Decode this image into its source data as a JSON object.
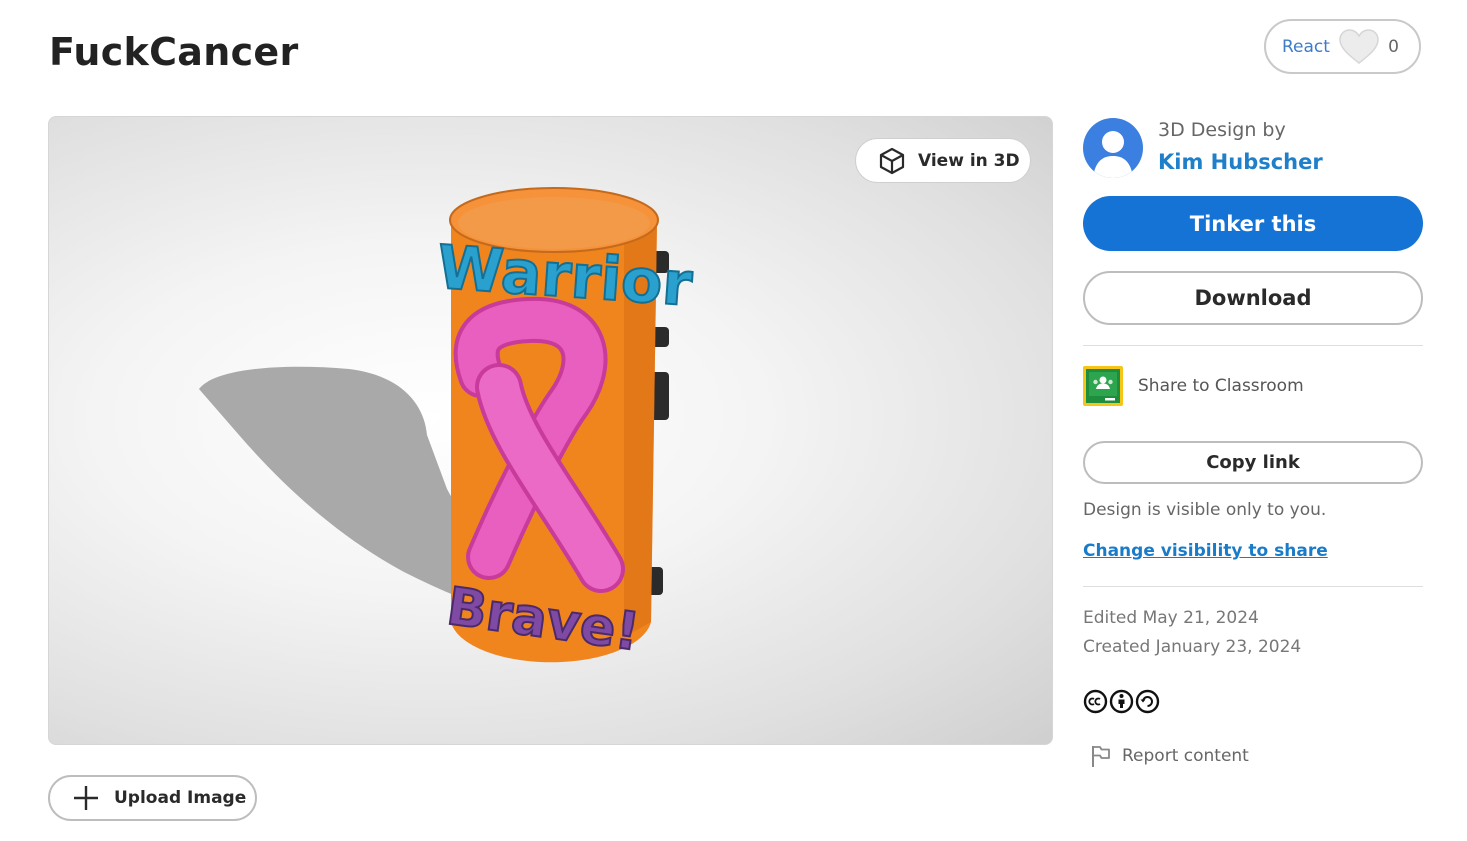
{
  "page": {
    "title": "FuckCancer"
  },
  "react": {
    "label": "React",
    "count": "0",
    "icon": "heart-icon"
  },
  "viewer": {
    "view3d_label": "View in 3D",
    "model_text_top": "Warrior",
    "model_text_bottom": "Brave!",
    "colors": {
      "body": "#f0851e",
      "ribbon": "#e85fc0",
      "top_text": "#2aa0cf",
      "bottom_text": "#7e4aa3"
    }
  },
  "upload": {
    "label": "Upload Image"
  },
  "sidebar": {
    "by_label": "3D Design by",
    "author": "Kim Hubscher",
    "tinker_label": "Tinker this",
    "download_label": "Download",
    "classroom_label": "Share to Classroom",
    "copy_label": "Copy link",
    "visibility_note": "Design is visible only to you.",
    "change_visibility": "Change visibility to share",
    "edited": "Edited May 21, 2024",
    "created": "Created January 23, 2024",
    "report_label": "Report content"
  },
  "colors": {
    "accent": "#1473d4",
    "link": "#1a7cc9"
  }
}
